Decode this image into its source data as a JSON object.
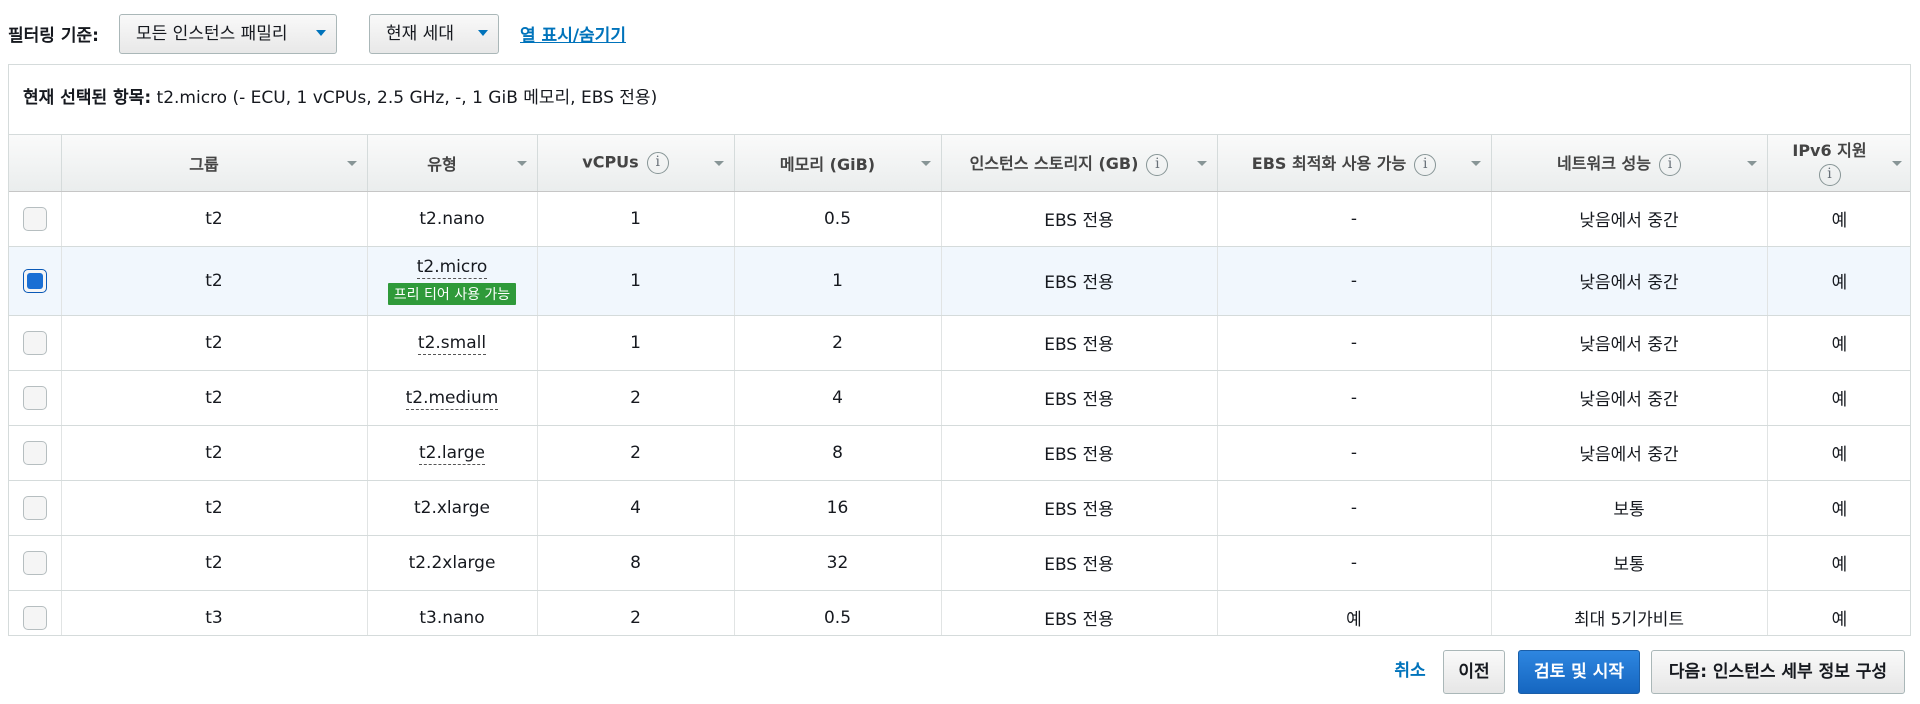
{
  "filter": {
    "label": "필터링 기준:",
    "family_selected": "모든 인스턴스 패밀리",
    "generation_selected": "현재 세대",
    "toggle_columns_link": "열 표시/숨기기"
  },
  "selected_info": {
    "label": "현재 선택된 항목:",
    "value": "t2.micro (- ECU, 1 vCPUs, 2.5 GHz, -, 1 GiB 메모리, EBS 전용)"
  },
  "table": {
    "headers": {
      "group": "그룹",
      "type": "유형",
      "vcpus": "vCPUs",
      "memory": "메모리 (GiB)",
      "storage": "인스턴스 스토리지 (GB)",
      "ebs_optimized": "EBS 최적화 사용 가능",
      "network": "네트워크 성능",
      "ipv6": "IPv6 지원"
    },
    "info_glyph": "i",
    "free_tier_badge": "프리 티어 사용 가능",
    "rows": [
      {
        "group": "t2",
        "type": "t2.nano",
        "vcpus": "1",
        "memory": "0.5",
        "storage": "EBS 전용",
        "ebs": "-",
        "network": "낮음에서 중간",
        "ipv6": "예",
        "selected": false
      },
      {
        "group": "t2",
        "type": "t2.micro",
        "vcpus": "1",
        "memory": "1",
        "storage": "EBS 전용",
        "ebs": "-",
        "network": "낮음에서 중간",
        "ipv6": "예",
        "selected": true
      },
      {
        "group": "t2",
        "type": "t2.small",
        "vcpus": "1",
        "memory": "2",
        "storage": "EBS 전용",
        "ebs": "-",
        "network": "낮음에서 중간",
        "ipv6": "예",
        "selected": false
      },
      {
        "group": "t2",
        "type": "t2.medium",
        "vcpus": "2",
        "memory": "4",
        "storage": "EBS 전용",
        "ebs": "-",
        "network": "낮음에서 중간",
        "ipv6": "예",
        "selected": false
      },
      {
        "group": "t2",
        "type": "t2.large",
        "vcpus": "2",
        "memory": "8",
        "storage": "EBS 전용",
        "ebs": "-",
        "network": "낮음에서 중간",
        "ipv6": "예",
        "selected": false
      },
      {
        "group": "t2",
        "type": "t2.xlarge",
        "vcpus": "4",
        "memory": "16",
        "storage": "EBS 전용",
        "ebs": "-",
        "network": "보통",
        "ipv6": "예",
        "selected": false
      },
      {
        "group": "t2",
        "type": "t2.2xlarge",
        "vcpus": "8",
        "memory": "32",
        "storage": "EBS 전용",
        "ebs": "-",
        "network": "보통",
        "ipv6": "예",
        "selected": false
      },
      {
        "group": "t3",
        "type": "t3.nano",
        "vcpus": "2",
        "memory": "0.5",
        "storage": "EBS 전용",
        "ebs": "예",
        "network": "최대 5기가비트",
        "ipv6": "예",
        "selected": false
      }
    ]
  },
  "footer": {
    "cancel": "취소",
    "previous": "이전",
    "review_launch": "검토 및 시작",
    "next": "다음: 인스턴스 세부 정보 구성"
  },
  "colors": {
    "link": "#0073bb",
    "primary_button": "#1566c0",
    "free_tier_badge": "#2f9a3a",
    "selected_row": "#f1f7fd"
  }
}
